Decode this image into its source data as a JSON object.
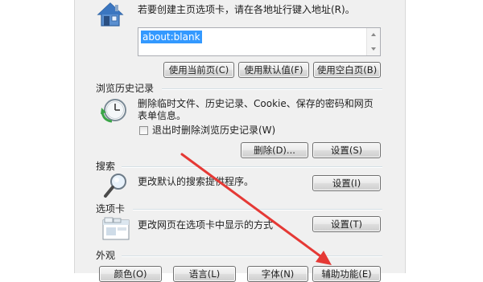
{
  "home_page": {
    "instruction": "若要创建主页选项卡，请在各地址行键入地址(R)。",
    "address": "about:blank",
    "buttons": {
      "use_current": "使用当前页(C)",
      "use_default": "使用默认值(F)",
      "use_blank": "使用空白页(B)"
    },
    "icon": "house-icon"
  },
  "browsing_history": {
    "title": "浏览历史记录",
    "description_line1": "删除临时文件、历史记录、Cookie、保存的密码和网页",
    "description_line2": "表单信息。",
    "checkbox_label": "退出时删除浏览历史记录(W)",
    "checkbox_checked": false,
    "delete_button": "删除(D)...",
    "settings_button": "设置(S)",
    "icon": "clock-arrow-icon"
  },
  "search": {
    "title": "搜索",
    "description": "更改默认的搜索提供程序。",
    "settings_button": "设置(I)",
    "icon": "magnifier-icon"
  },
  "tabs": {
    "title": "选项卡",
    "description": "更改网页在选项卡中显示的方式",
    "settings_button": "设置(T)",
    "icon": "tabs-window-icon"
  },
  "appearance": {
    "title": "外观",
    "buttons": {
      "colors": "颜色(O)",
      "languages": "语言(L)",
      "fonts": "字体(N)",
      "accessibility": "辅助功能(E)"
    }
  },
  "annotation": {
    "arrow_color": "#e53935"
  }
}
